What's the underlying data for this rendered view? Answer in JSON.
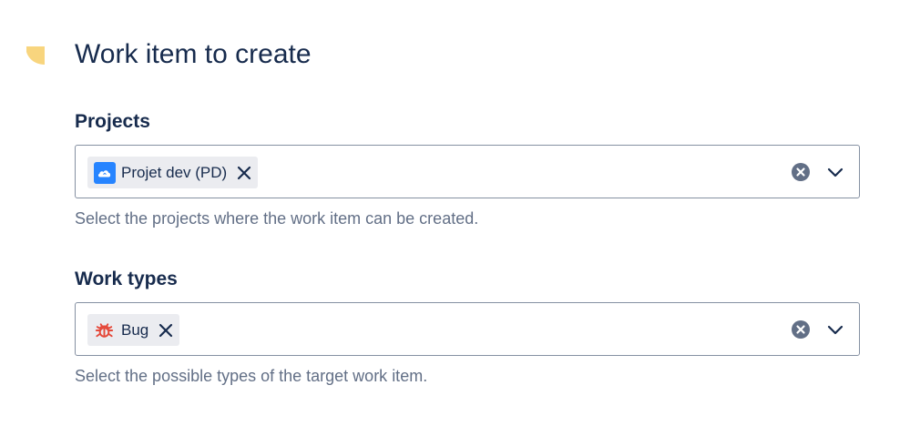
{
  "header": {
    "title": "Work item to create",
    "marker_color": "#F8D57E",
    "marker_icon": "flag-marker-icon"
  },
  "projects": {
    "label": "Projects",
    "chips": [
      {
        "label": "Projet dev (PD)",
        "icon": "cloud-project-icon",
        "icon_color": "#2684FF"
      }
    ],
    "helper": "Select the projects where the work item can be created."
  },
  "work_types": {
    "label": "Work types",
    "chips": [
      {
        "label": "Bug",
        "icon": "bug-icon",
        "icon_color": "#E5493A"
      }
    ],
    "helper": "Select the possible types of the target work item."
  },
  "colors": {
    "text": "#172B4D",
    "helper_text": "#626F86",
    "border": "#8590A2",
    "chip_bg": "#EBECF0",
    "clear_icon": "#626F86"
  }
}
